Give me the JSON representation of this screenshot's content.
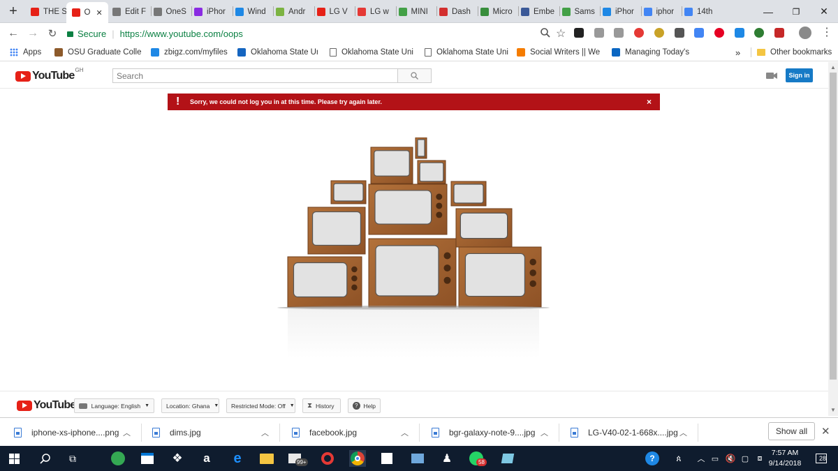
{
  "browser": {
    "tabs": [
      {
        "title": "THE S",
        "icon": "youtube-icon",
        "color": "#e62117"
      },
      {
        "title": "O",
        "icon": "youtube-icon",
        "color": "#e62117",
        "active": true
      },
      {
        "title": "Edit F",
        "icon": "document-icon",
        "color": "#777777"
      },
      {
        "title": "OneS",
        "icon": "document-icon",
        "color": "#777777"
      },
      {
        "title": "iPhor",
        "icon": "verge-icon",
        "color": "#8a2be2"
      },
      {
        "title": "Wind",
        "icon": "windows-central-icon",
        "color": "#1e88e5"
      },
      {
        "title": "Andr",
        "icon": "android-icon",
        "color": "#7cb342"
      },
      {
        "title": "LG V",
        "icon": "youtube-icon",
        "color": "#e62117"
      },
      {
        "title": "LG w",
        "icon": "h-icon",
        "color": "#e53935"
      },
      {
        "title": "MINI",
        "icon": "pencil-icon",
        "color": "#43a047"
      },
      {
        "title": "Dash",
        "icon": "dash-icon",
        "color": "#d32f2f"
      },
      {
        "title": "Micro",
        "icon": "clock-icon",
        "color": "#388e3c"
      },
      {
        "title": "Embe",
        "icon": "facebook-icon",
        "color": "#3b5998"
      },
      {
        "title": "Sams",
        "icon": "chat-icon",
        "color": "#43a047"
      },
      {
        "title": "iPhor",
        "icon": "g-icon",
        "color": "#1e88e5"
      },
      {
        "title": "iphor",
        "icon": "google-icon",
        "color": "#4285f4"
      },
      {
        "title": "14th",
        "icon": "google-icon",
        "color": "#4285f4"
      }
    ],
    "new_tab_symbol": "+",
    "close_symbol": "✕",
    "window_buttons": [
      "—",
      "❐",
      "✕"
    ],
    "secure_label": "Secure",
    "url": "https://www.youtube.com/oops",
    "bookmarks": [
      {
        "label": "Apps",
        "icon": "apps-grid-icon"
      },
      {
        "label": "OSU Graduate Colle",
        "icon": "hat-icon"
      },
      {
        "label": "zbigz.com/myfiles",
        "icon": "z-icon"
      },
      {
        "label": "Oklahoma State Uni",
        "icon": "osu-icon"
      },
      {
        "label": "Oklahoma State Uni",
        "icon": "document-icon"
      },
      {
        "label": "Oklahoma State Uni",
        "icon": "document-icon"
      },
      {
        "label": "Social Writers || We",
        "icon": "blogger-icon"
      },
      {
        "label": "Managing Today's D",
        "icon": "linkedin-icon"
      }
    ],
    "bookmarks_overflow": "»",
    "other_bookmarks": "Other bookmarks"
  },
  "youtube": {
    "logo_text": "YouTube",
    "country_code": "GH",
    "search_placeholder": "Search",
    "sign_in": "Sign in",
    "error_message": "Sorry, we could not log you in at this time. Please try again later.",
    "error_icon": "!",
    "error_close": "×",
    "footer": {
      "logo_text": "YouTube",
      "language": "Language: English",
      "location": "Location: Ghana",
      "restricted": "Restricted Mode: Off",
      "history": "History",
      "help": "Help"
    }
  },
  "downloads": {
    "items": [
      "iphone-xs-iphone....png",
      "dims.jpg",
      "facebook.jpg",
      "bgr-galaxy-note-9....jpg",
      "LG-V40-02-1-668x....jpg"
    ],
    "show_all": "Show all"
  },
  "taskbar": {
    "time": "7:57 AM",
    "date": "9/14/2018",
    "notification_count": "28",
    "badge_99": "99+",
    "badge_58": "58"
  }
}
